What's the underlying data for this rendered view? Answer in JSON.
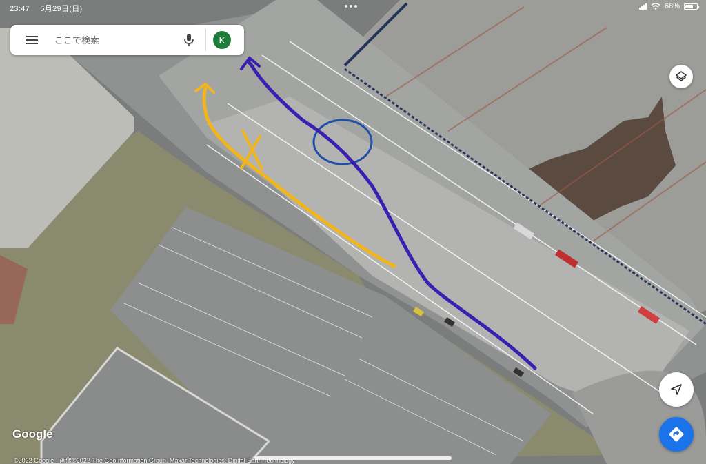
{
  "status_bar": {
    "time": "23:47",
    "date": "5月29日(日)",
    "battery": "68%",
    "battery_level": 0.68
  },
  "search": {
    "placeholder": "ここで検索",
    "avatar_initial": "K"
  },
  "map": {
    "logo": "Google",
    "attribution": "©2022 Google · 画像©2022 The GeoInformation Group, Maxar Technologies, Digital Earth Technology",
    "annotation_colors": {
      "route_purple": "#3b1fb0",
      "route_yellow": "#f2b51c",
      "circle_blue": "#1f4fa6"
    }
  },
  "controls": {
    "layers": "layers-icon",
    "locate": "navigation-arrow-icon",
    "directions": "directions-icon",
    "directions_color": "#1a73e8"
  }
}
